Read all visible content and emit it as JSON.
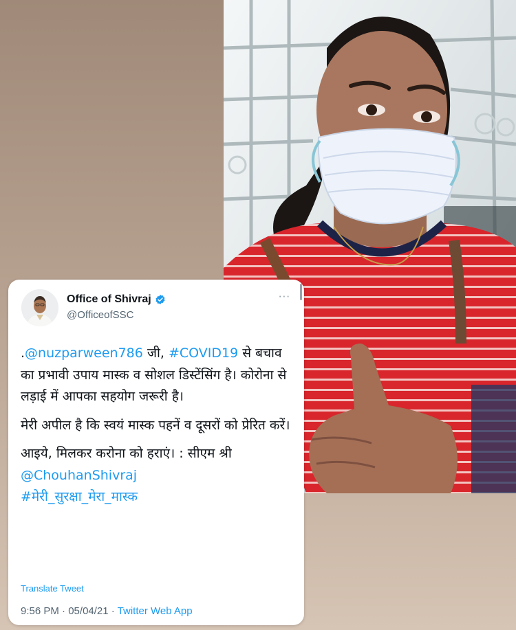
{
  "photo": {
    "description_icon": "selfie-photo"
  },
  "tweet": {
    "display_name": "Office of Shivraj",
    "handle": "@OfficeofSSC",
    "more_label": "···",
    "verified_icon": "verified-badge-icon",
    "paragraph1": {
      "prefix": ".",
      "mention": "@nuzparween786",
      "text1": " जी, ",
      "hashtag": "#COVID19",
      "text2": " से बचाव का प्रभावी उपाय मास्क व सोशल डिस्टेंसिंग है। कोरोना से लड़ाई में आपका सहयोग जरूरी है।"
    },
    "paragraph2": "मेरी अपील है कि स्वयं मास्क पहनें व दूसरों को प्रेरित करें।",
    "paragraph3": {
      "text": "आइये, मिलकर करोना को हराएं। : सीएम श्री",
      "mention": "@ChouhanShivraj",
      "hashtag": "#मेरी_सुरक्षा_मेरा_मास्क"
    },
    "translate_label": "Translate Tweet",
    "time": "9:56 PM",
    "separator1": " · ",
    "date": "05/04/21",
    "separator2": " · ",
    "source_app": "Twitter Web App"
  },
  "colors": {
    "link": "#1d9bf0",
    "text": "#0f1419",
    "secondary": "#536471",
    "shirt_red": "#d42a2e"
  }
}
